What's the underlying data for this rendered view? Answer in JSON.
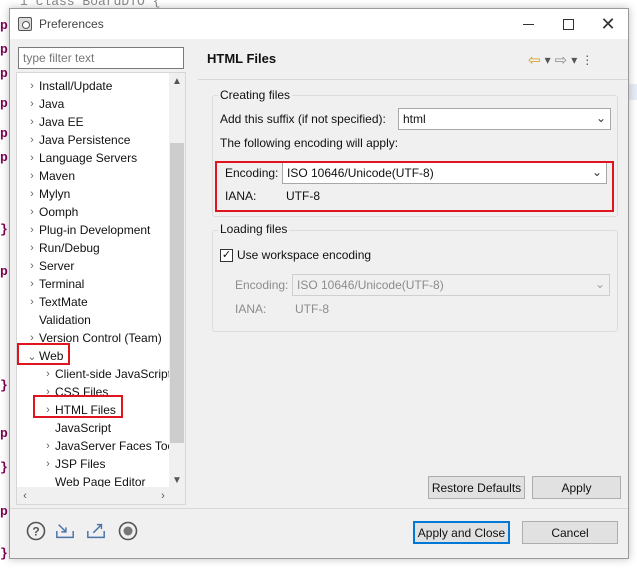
{
  "dialog": {
    "title": "Preferences",
    "filter_placeholder": "type filter text"
  },
  "background_editor": {
    "top_text": "i class BoardDTO {",
    "gutter_markers": [
      "p",
      "p",
      "p",
      "p",
      "p",
      "p",
      "}",
      "p",
      "}",
      "p",
      "}",
      "p",
      "}"
    ]
  },
  "tree": {
    "items": [
      {
        "label": "Install/Update",
        "expander": "›"
      },
      {
        "label": "Java",
        "expander": "›"
      },
      {
        "label": "Java EE",
        "expander": "›"
      },
      {
        "label": "Java Persistence",
        "expander": "›"
      },
      {
        "label": "Language Servers",
        "expander": "›"
      },
      {
        "label": "Maven",
        "expander": "›"
      },
      {
        "label": "Mylyn",
        "expander": "›"
      },
      {
        "label": "Oomph",
        "expander": "›"
      },
      {
        "label": "Plug-in Development",
        "expander": "›"
      },
      {
        "label": "Run/Debug",
        "expander": "›"
      },
      {
        "label": "Server",
        "expander": "›"
      },
      {
        "label": "Terminal",
        "expander": "›"
      },
      {
        "label": "TextMate",
        "expander": "›"
      },
      {
        "label": "Validation",
        "expander": ""
      },
      {
        "label": "Version Control (Team)",
        "expander": "›"
      },
      {
        "label": "Web",
        "expander": "⌄"
      },
      {
        "label": "Client-side JavaScript",
        "expander": "›"
      },
      {
        "label": "CSS Files",
        "expander": "›"
      },
      {
        "label": "HTML Files",
        "expander": "›"
      },
      {
        "label": "JavaScript",
        "expander": ""
      },
      {
        "label": "JavaServer Faces Tools",
        "expander": "›"
      },
      {
        "label": "JSP Files",
        "expander": "›"
      },
      {
        "label": "Web Page Editor",
        "expander": ""
      }
    ]
  },
  "page": {
    "title": "HTML Files",
    "creating_files": {
      "group_label": "Creating files",
      "suffix_label": "Add this suffix (if not specified):",
      "suffix_value": "html",
      "encoding_intro": "The following encoding will apply:",
      "encoding_label": "Encoding:",
      "encoding_value": "ISO 10646/Unicode(UTF-8)",
      "iana_label": "IANA:",
      "iana_value": "UTF-8"
    },
    "loading_files": {
      "group_label": "Loading files",
      "checkbox_label": "Use workspace encoding",
      "checkbox_checked": true,
      "encoding_label": "Encoding:",
      "encoding_value": "ISO 10646/Unicode(UTF-8)",
      "iana_label": "IANA:",
      "iana_value": "UTF-8"
    },
    "buttons": {
      "restore_defaults": "Restore Defaults",
      "apply": "Apply"
    }
  },
  "footer": {
    "apply_and_close": "Apply and Close",
    "cancel": "Cancel",
    "icons": [
      "help-icon",
      "import-icon",
      "export-icon",
      "record-icon"
    ]
  },
  "colors": {
    "highlight": "#e0141e",
    "default_button_border": "#0078d7",
    "back_arrow": "#d59a10"
  }
}
